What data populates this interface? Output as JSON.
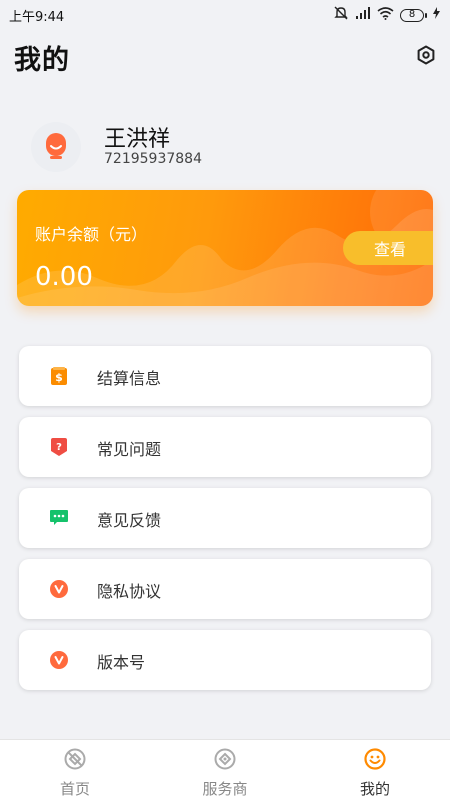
{
  "status_bar": {
    "time": "上午9:44",
    "battery": "8",
    "icons": [
      "mute-icon",
      "signal-icon",
      "wifi-icon",
      "battery-icon",
      "charging-icon"
    ]
  },
  "header": {
    "title": "我的",
    "settings_icon": "settings-hexagon-icon"
  },
  "profile": {
    "name": "王洪祥",
    "id": "72195937884",
    "avatar_icon": "smiley-avatar-icon"
  },
  "balance": {
    "label": "账户余额（元）",
    "value": "0.00",
    "view_label": "查看"
  },
  "menu": {
    "items": [
      {
        "label": "结算信息",
        "icon": "settlement-icon",
        "color": "#fb8c00"
      },
      {
        "label": "常见问题",
        "icon": "question-icon",
        "color": "#ef4d43"
      },
      {
        "label": "意见反馈",
        "icon": "feedback-icon",
        "color": "#15c26b"
      },
      {
        "label": "隐私协议",
        "icon": "privacy-icon",
        "color": "#ff6a3d"
      },
      {
        "label": "版本号",
        "icon": "version-icon",
        "color": "#ff6a3d"
      }
    ]
  },
  "bottom_nav": {
    "items": [
      {
        "label": "首页",
        "icon": "home-icon",
        "active": false
      },
      {
        "label": "服务商",
        "icon": "provider-icon",
        "active": false
      },
      {
        "label": "我的",
        "icon": "me-icon",
        "active": true
      }
    ],
    "active_color": "#ff8a00",
    "inactive_color": "#aaaaaa"
  },
  "colors": {
    "accent": "#ff8a00",
    "background": "#f1f2f5"
  }
}
